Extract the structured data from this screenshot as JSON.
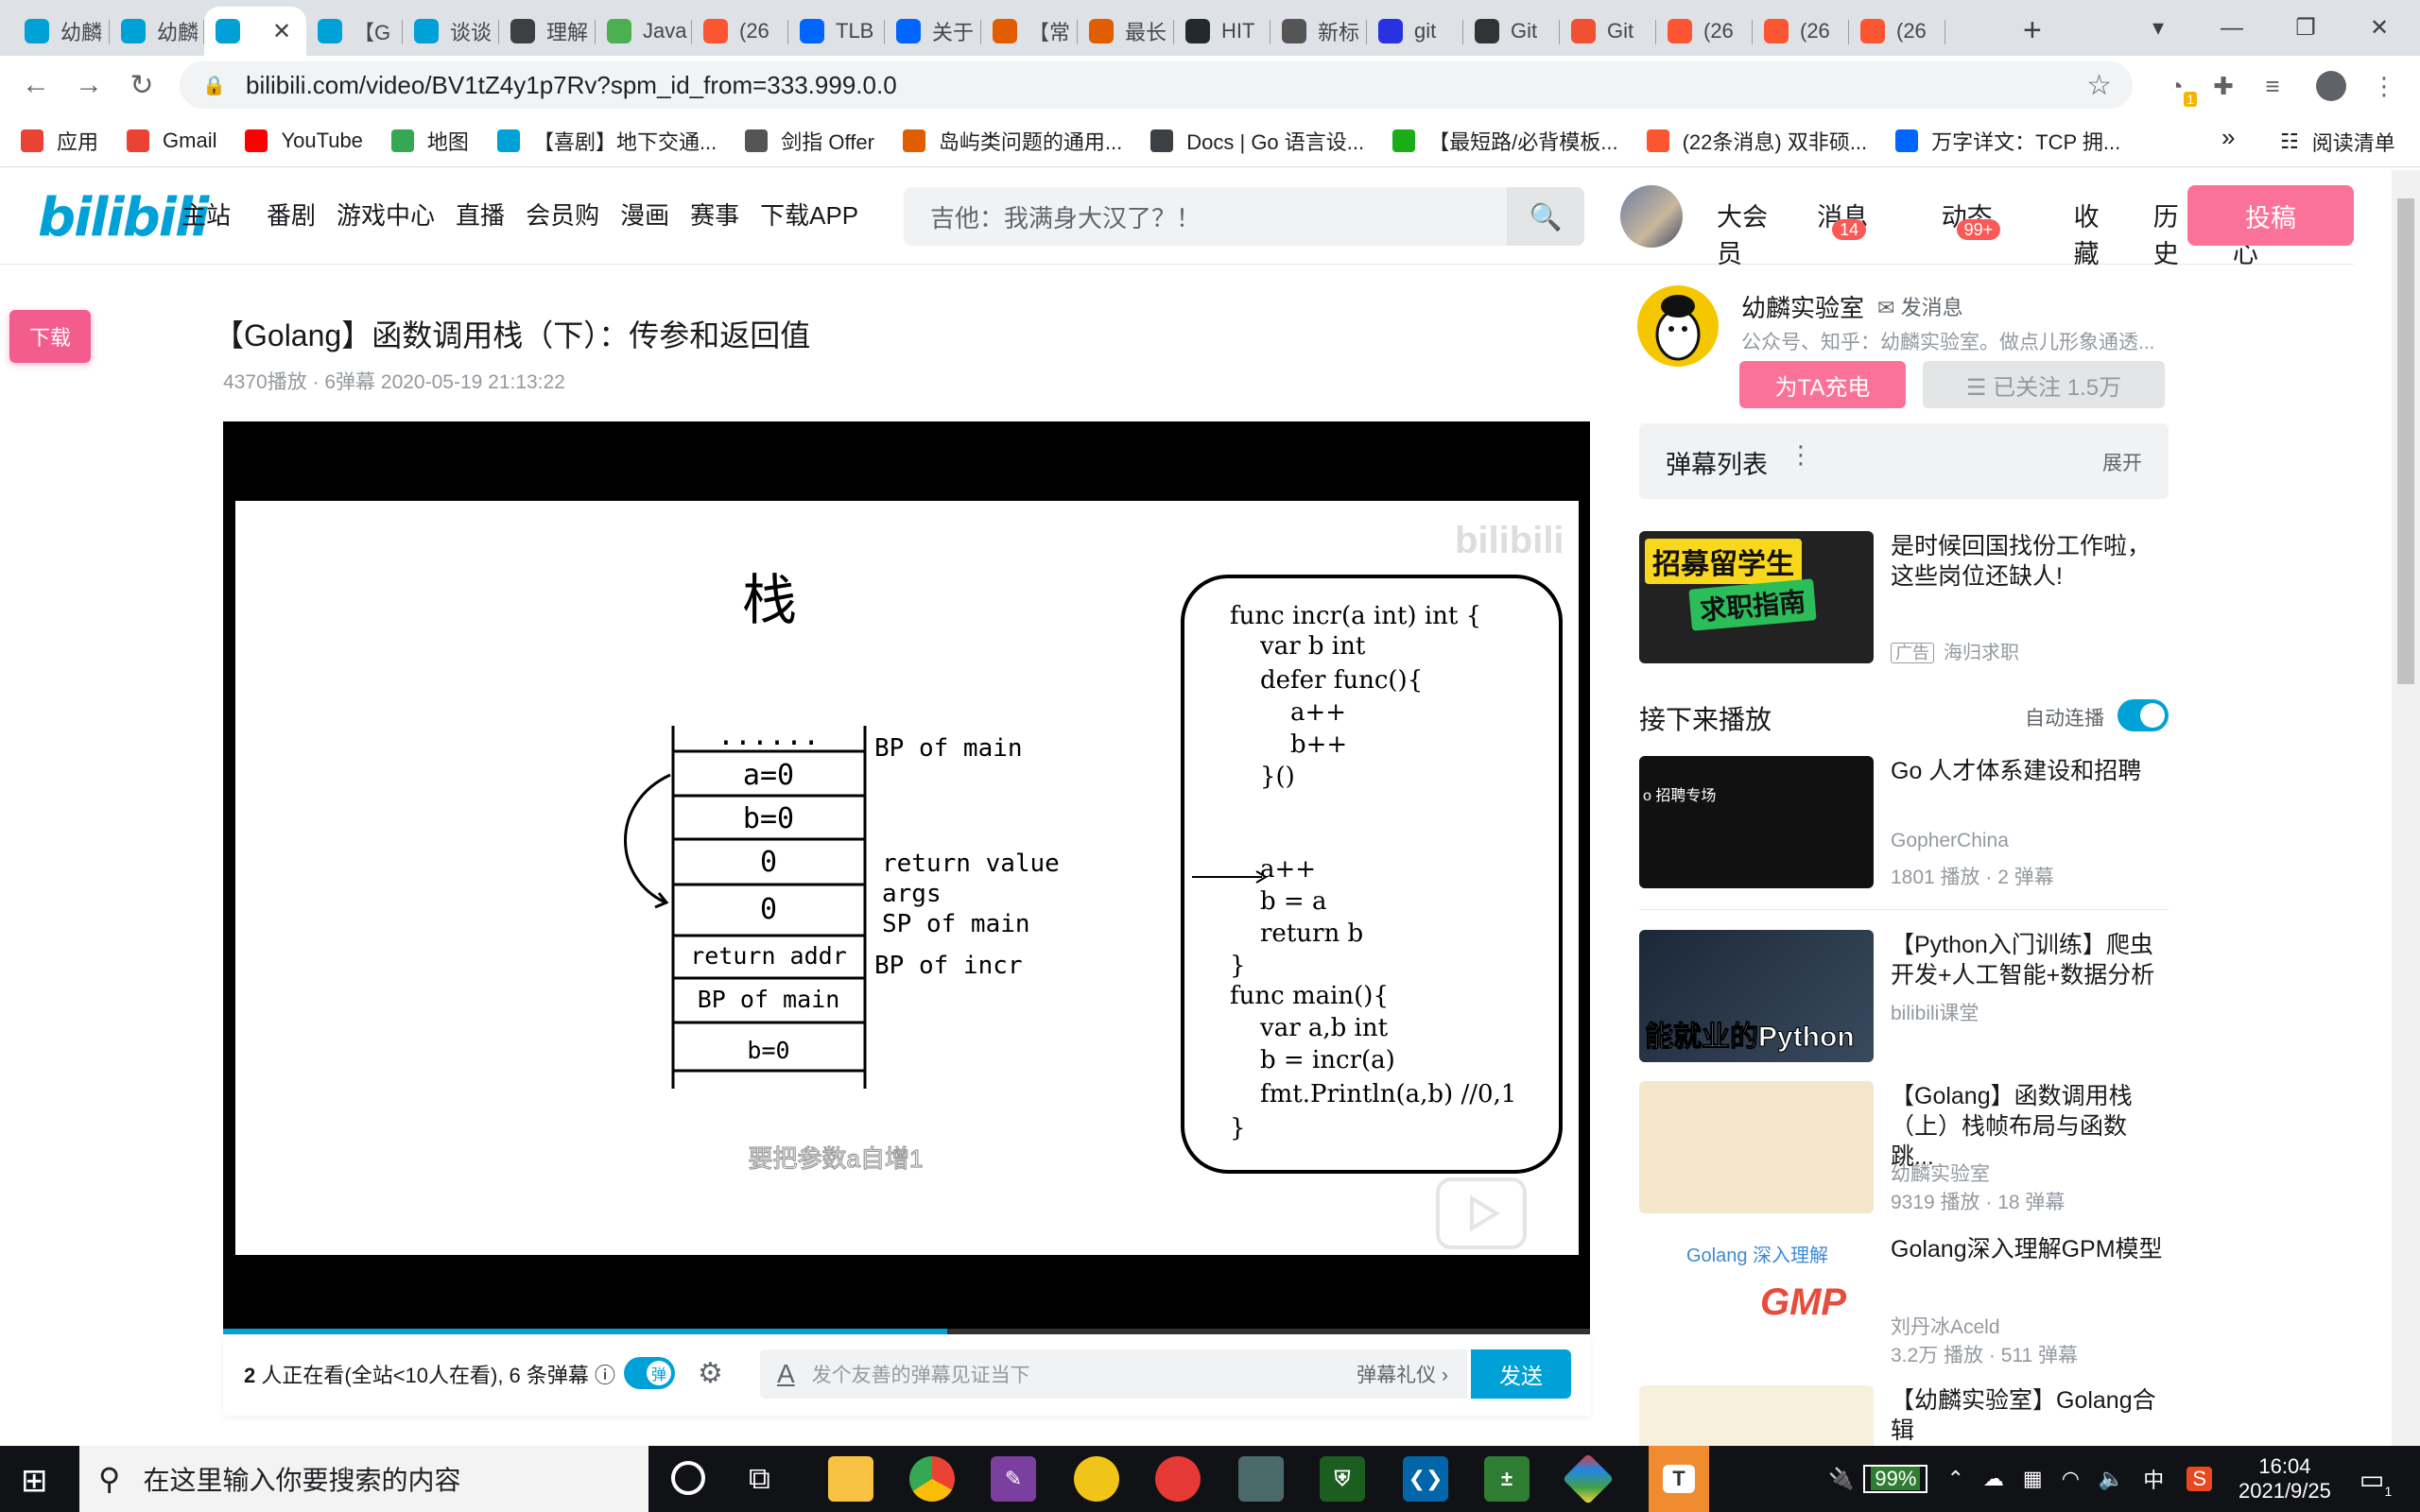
{
  "browser": {
    "tabs": [
      {
        "label": "幼麟",
        "icon": "bilibili-icon",
        "color": "#00a1d6"
      },
      {
        "label": "幼麟",
        "icon": "bilibili-icon",
        "color": "#00a1d6"
      },
      {
        "label": "",
        "icon": "bilibili-icon",
        "color": "#00a1d6",
        "active": true
      },
      {
        "label": "【G",
        "icon": "bilibili-icon",
        "color": "#00a1d6"
      },
      {
        "label": "谈谈",
        "icon": "bilibili-icon",
        "color": "#00a1d6"
      },
      {
        "label": "理解",
        "icon": "doc-icon",
        "color": "#3c4043"
      },
      {
        "label": "Java",
        "icon": "java-icon",
        "color": "#4caf50"
      },
      {
        "label": "(26",
        "icon": "csdn-icon",
        "color": "#fc5531"
      },
      {
        "label": "TLB",
        "icon": "zhihu-icon",
        "color": "#0066ff"
      },
      {
        "label": "关于",
        "icon": "zhihu-icon",
        "color": "#0066ff"
      },
      {
        "label": "【常",
        "icon": "juejin-icon",
        "color": "#e05d00"
      },
      {
        "label": "最长",
        "icon": "juejin-icon",
        "color": "#e05d00"
      },
      {
        "label": "HIT",
        "icon": "github-icon",
        "color": "#24292e"
      },
      {
        "label": "新标",
        "icon": "chrome-icon",
        "color": "#555"
      },
      {
        "label": "git",
        "icon": "baidu-icon",
        "color": "#2932e1"
      },
      {
        "label": "Git",
        "icon": "git-icon",
        "color": "#333"
      },
      {
        "label": "Git",
        "icon": "gitee-icon",
        "color": "#f05133"
      },
      {
        "label": "(26",
        "icon": "csdn-icon",
        "color": "#fc5531"
      },
      {
        "label": "(26",
        "icon": "csdn-icon",
        "color": "#fc5531"
      },
      {
        "label": "(26",
        "icon": "csdn-icon",
        "color": "#fc5531"
      }
    ],
    "url": "bilibili.com/video/BV1tZ4y1p7Rv?spm_id_from=333.999.0.0",
    "bookmarks": [
      {
        "label": "应用",
        "icon": "apps-icon",
        "color": "#ea4335"
      },
      {
        "label": "Gmail",
        "icon": "gmail-icon",
        "color": "#ea4335"
      },
      {
        "label": "YouTube",
        "icon": "youtube-icon",
        "color": "#ff0000"
      },
      {
        "label": "地图",
        "icon": "maps-icon",
        "color": "#34a853"
      },
      {
        "label": "【喜剧】地下交通...",
        "icon": "bilibili-icon",
        "color": "#00a1d6"
      },
      {
        "label": "剑指 Offer",
        "icon": "leetcode-icon",
        "color": "#555"
      },
      {
        "label": "岛屿类问题的通用...",
        "icon": "juejin-icon",
        "color": "#e05d00"
      },
      {
        "label": "Docs | Go 语言设...",
        "icon": "doc-icon",
        "color": "#3c4043"
      },
      {
        "label": "【最短路/必背模板...",
        "icon": "wechat-icon",
        "color": "#1aad19"
      },
      {
        "label": "(22条消息) 双非硕...",
        "icon": "csdn-icon",
        "color": "#fc5531"
      },
      {
        "label": "万字详文：TCP 拥...",
        "icon": "zhihu-icon",
        "color": "#0066ff"
      }
    ],
    "more_bookmarks": "»",
    "reading_list": "阅读清单",
    "ext_badge": "1"
  },
  "site": {
    "logo": "bilibili",
    "nav": [
      "主站",
      "番剧",
      "游戏中心",
      "直播",
      "会员购",
      "漫画",
      "赛事",
      "下载APP"
    ],
    "search_placeholder": "吉他：我满身大汉了？！",
    "right_nav": [
      {
        "label": "大会员",
        "badge": ""
      },
      {
        "label": "消息",
        "badge": "14"
      },
      {
        "label": "动态",
        "badge": "99+"
      },
      {
        "label": "收藏",
        "badge": ""
      },
      {
        "label": "历史",
        "badge": ""
      },
      {
        "label": "创作中心",
        "badge": ""
      }
    ],
    "upload": "投稿",
    "download_float": "下载"
  },
  "video": {
    "title": "【Golang】函数调用栈（下）：传参和返回值",
    "meta": "4370播放 · 6弹幕   2020-05-19 21:13:22",
    "progress_fraction": 0.53,
    "frame": {
      "stack_title": "栈",
      "cells": [
        "......",
        "a=0",
        "b=0",
        "0",
        "0",
        "return addr",
        "BP of main",
        "b=0"
      ],
      "labels": [
        "BP of main",
        "return value",
        "args",
        "SP of main",
        "BP of incr"
      ],
      "code": [
        "func incr(a int) int {",
        "  var b int",
        "",
        "  defer func(){",
        "    a++",
        "    b++",
        "  }()",
        "",
        "  a++",
        "  b = a",
        "  return b",
        "}",
        "func main(){",
        "  var a,b int",
        "  b = incr(a)",
        "  fmt.Println(a,b) //0,1",
        "}"
      ],
      "subtitle": "要把参数a自增1",
      "watermark": "bilibili"
    },
    "danmaku_bar": {
      "watching_count": "2",
      "watching_text": " 人正在看(全站<10人在看), 6 条弹幕",
      "toggle_label": "弹",
      "input_placeholder": "发个友善的弹幕见证当下",
      "etiquette": "弹幕礼仪 ›",
      "send": "发送"
    }
  },
  "uploader": {
    "name": "幼麟实验室",
    "message": "发消息",
    "desc": "公众号、知乎：幼麟实验室。做点儿形象通透...",
    "charge": "为TA充电",
    "follow": "☰ 已关注 1.5万"
  },
  "danmaku_list": {
    "title": "弹幕列表",
    "expand": "展开"
  },
  "ad": {
    "title": "是时候回国找份工作啦，这些岗位还缺人!",
    "tag": "广告",
    "source": "海归求职",
    "thumb_text1": "招募留学生",
    "thumb_text2": "求职指南"
  },
  "next": {
    "label": "接下来播放",
    "autoplay": "自动连播"
  },
  "recommendations": [
    {
      "title": "Go 人才体系建设和招聘",
      "author": "GopherChina",
      "stats": "1801 播放 · 2 弹幕",
      "thumb_text": "o 招聘专场"
    },
    {
      "title": "【Python入门训练】爬虫开发+人工智能+数据分析",
      "author": "bilibili课堂",
      "stats": "",
      "thumb_text": "能就业的Python"
    },
    {
      "title": "【Golang】函数调用栈（上）栈帧布局与函数跳...",
      "author": "幼麟实验室",
      "stats": "9319 播放 · 18 弹幕",
      "thumb_text": ""
    },
    {
      "title": "Golang深入理解GPM模型",
      "author": "刘丹冰Aceld",
      "stats": "3.2万 播放 · 511 弹幕",
      "thumb_text": "GMP",
      "thumb_text2": "Golang 深入理解"
    },
    {
      "title": "【幼麟实验室】Golang合辑",
      "author": "",
      "stats": "",
      "thumb_text": ""
    }
  ],
  "taskbar": {
    "search_placeholder": "在这里输入你要搜索的内容",
    "battery": "99%",
    "ime": "中",
    "time": "16:04",
    "date": "2021/9/25",
    "notif": "1"
  }
}
